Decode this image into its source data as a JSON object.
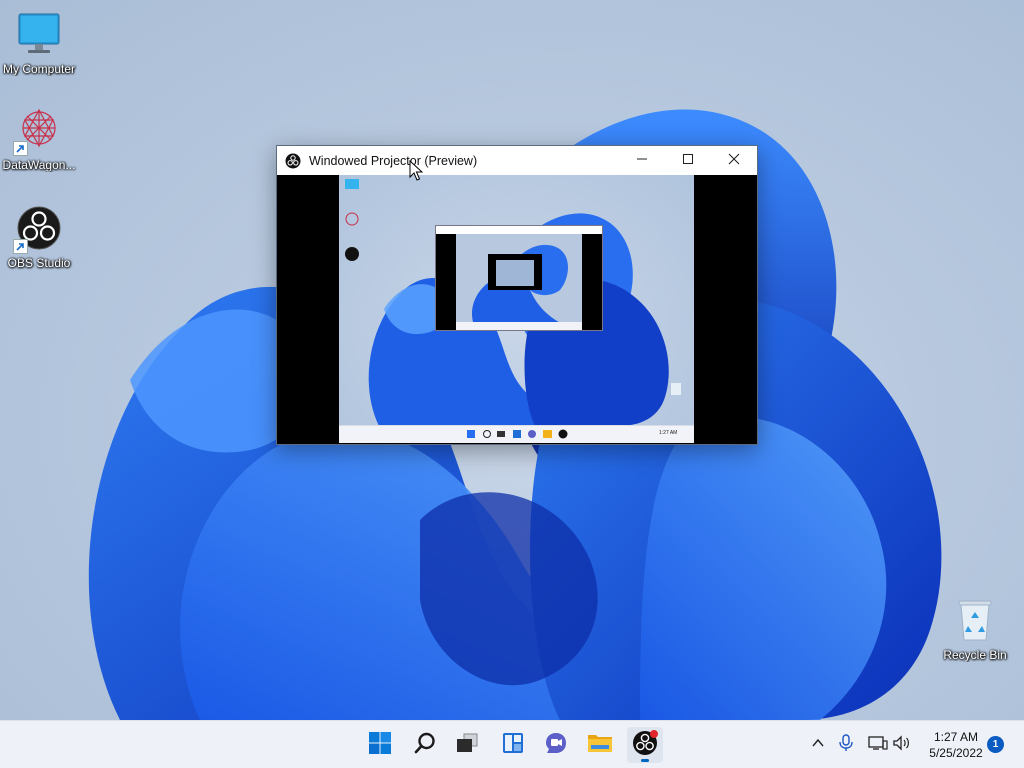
{
  "desktop": {
    "icons": [
      {
        "label": "My Computer",
        "icon": "monitor-icon"
      },
      {
        "label": "DataWagon...",
        "icon": "datawagon-icon"
      },
      {
        "label": "OBS Studio",
        "icon": "obs-icon"
      },
      {
        "label": "Recycle Bin",
        "icon": "recycle-bin-icon"
      }
    ]
  },
  "projector": {
    "title": "Windowed Projector (Preview)",
    "minimize_icon": "minimize-icon",
    "maximize_icon": "maximize-icon",
    "close_icon": "close-icon"
  },
  "taskbar": {
    "apps": [
      {
        "name": "Start",
        "icon": "windows-start-icon"
      },
      {
        "name": "Search",
        "icon": "search-icon"
      },
      {
        "name": "Task View",
        "icon": "task-view-icon"
      },
      {
        "name": "Widgets",
        "icon": "widgets-icon"
      },
      {
        "name": "Chat",
        "icon": "chat-icon"
      },
      {
        "name": "File Explorer",
        "icon": "folder-icon"
      },
      {
        "name": "OBS Studio",
        "icon": "obs-icon",
        "active": true
      }
    ],
    "tray": {
      "chevron_icon": "chevron-up-icon",
      "mic_icon": "microphone-icon",
      "network_icon": "network-icon",
      "volume_icon": "volume-icon"
    },
    "clock": {
      "time": "1:27 AM",
      "date": "5/25/2022"
    },
    "notification_count": "1"
  },
  "colors": {
    "accent": "#0067c0",
    "wallpaper_blue": "#1450e0",
    "taskbar_bg": "#eef1f7"
  }
}
